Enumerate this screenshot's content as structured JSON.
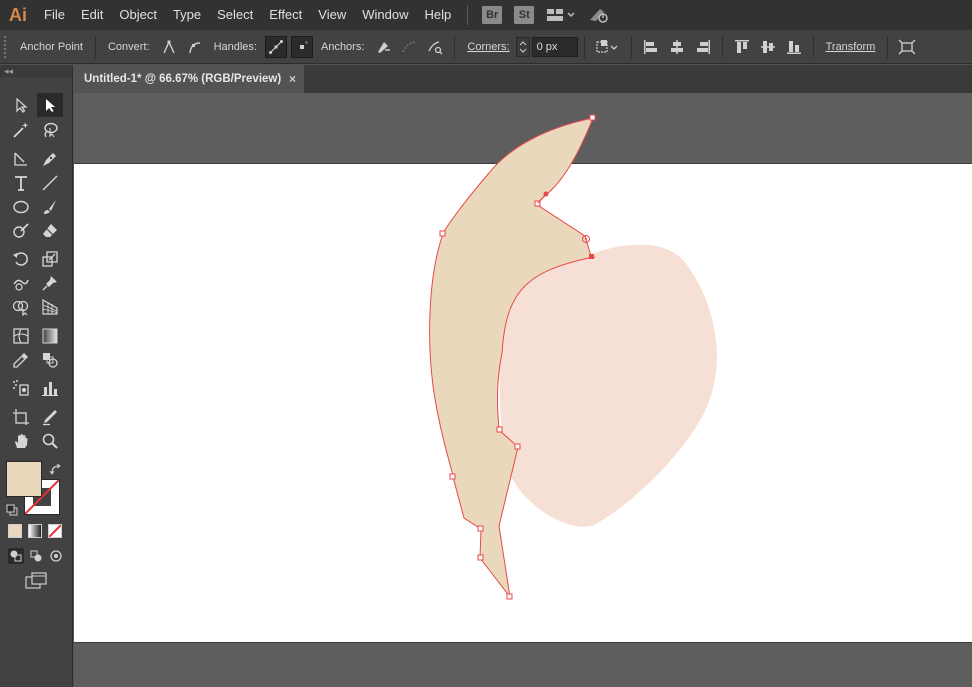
{
  "app": {
    "logo": "Ai"
  },
  "menu": [
    "File",
    "Edit",
    "Object",
    "Type",
    "Select",
    "Effect",
    "View",
    "Window",
    "Help"
  ],
  "bridge_button": "Br",
  "stock_button": "St",
  "control_bar": {
    "tool_name": "Anchor Point",
    "convert_label": "Convert:",
    "handles_label": "Handles:",
    "anchors_label": "Anchors:",
    "corners_label": "Corners:",
    "corners_value": "0 px",
    "transform_label": "Transform"
  },
  "panel_collapse": "◂◂",
  "document_tab": {
    "title": "Untitled-1* @ 66.67% (RGB/Preview)",
    "close": "×"
  },
  "colors": {
    "fill_swatch": "#ead8bd",
    "heart_fill": "#f6e0d6",
    "leaf_fill": "#ead8bd",
    "path_stroke": "#e8484a",
    "accent": "#d2894a"
  },
  "icons": {
    "select": "selection-arrow-icon",
    "direct_select": "direct-selection-icon",
    "magic_wand": "magic-wand-icon",
    "lasso": "lasso-icon",
    "pen": "pen-icon",
    "curvature": "curvature-icon",
    "type": "type-icon",
    "line": "line-segment-icon",
    "ellipse": "ellipse-icon",
    "paintbrush": "paintbrush-icon",
    "shaper": "shaper-icon",
    "eraser": "eraser-icon",
    "rotate": "rotate-icon",
    "scale": "scale-icon",
    "warp": "warp-icon",
    "pin": "puppet-warp-icon",
    "shape_builder": "shape-builder-icon",
    "perspective": "perspective-grid-icon",
    "mesh": "mesh-icon",
    "gradient": "gradient-icon",
    "eyedropper": "eyedropper-icon",
    "blend": "blend-icon",
    "symbol_sprayer": "symbol-sprayer-icon",
    "graph": "column-graph-icon",
    "artboard": "artboard-icon",
    "slice": "slice-icon",
    "hand": "hand-icon",
    "zoom": "zoom-icon"
  }
}
